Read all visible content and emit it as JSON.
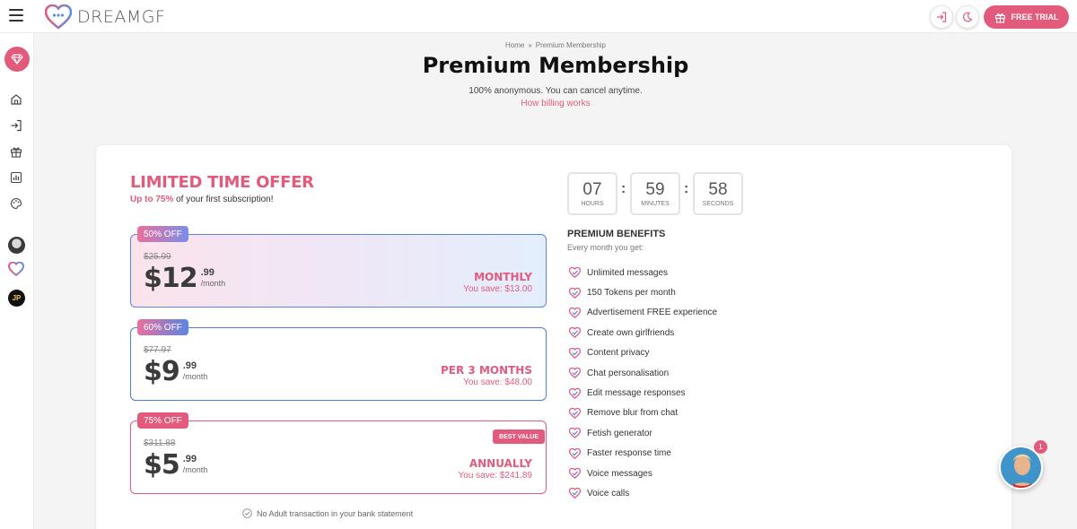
{
  "header": {
    "logo_text": "DREAMGF",
    "free_trial_label": "FREE TRIAL",
    "icons": [
      "menu-icon",
      "login-icon",
      "moon-icon",
      "gift-icon"
    ]
  },
  "sidebar": {
    "icons": [
      "diamond-icon",
      "home-icon",
      "login-icon",
      "gift-icon",
      "chart-icon",
      "palette-icon"
    ],
    "avatars": [
      "anime-avatar",
      "heart-avatar"
    ],
    "user_initials": "JP"
  },
  "breadcrumb": {
    "home": "Home",
    "separator": "»",
    "current": "Premium Membership"
  },
  "page": {
    "title": "Premium Membership",
    "subtitle": "100% anonymous. You can cancel anytime.",
    "billing_link": "How billing works"
  },
  "offer": {
    "title": "LIMITED TIME OFFER",
    "subtitle_highlight": "Up to 75%",
    "subtitle_rest": " of your first subscription!"
  },
  "plans": [
    {
      "discount": "50% OFF",
      "old_price": "$25.99",
      "price_main": "$12",
      "price_cents": ".99",
      "per": "/month",
      "period": "MONTHLY",
      "save": "You save: $13.00",
      "selected": true
    },
    {
      "discount": "60% OFF",
      "old_price": "$77.97",
      "price_main": "$9",
      "price_cents": ".99",
      "per": "/month",
      "period": "PER 3 MONTHS",
      "save": "You save: $48.00"
    },
    {
      "discount": "75% OFF",
      "old_price": "$311.88",
      "price_main": "$5",
      "price_cents": ".99",
      "per": "/month",
      "period": "ANNUALLY",
      "save": "You save: $241.89",
      "best_value": "BEST VALUE"
    }
  ],
  "no_adult": "No Adult transaction in your bank statement",
  "countdown": {
    "hours": "07",
    "hours_label": "HOURS",
    "minutes": "59",
    "minutes_label": "MINUTES",
    "seconds": "58",
    "seconds_label": "SECONDS",
    "separator": ":"
  },
  "benefits": {
    "title": "PREMIUM BENEFITS",
    "subtitle": "Every month you get:",
    "items": [
      "Unlimited messages",
      "150 Tokens per month",
      "Advertisement FREE experience",
      "Create own girlfriends",
      "Content privacy",
      "Chat personalisation",
      "Edit message responses",
      "Remove blur from chat",
      "Fetish generator",
      "Faster response time",
      "Voice messages",
      "Voice calls"
    ]
  },
  "chat": {
    "unread_count": "1"
  },
  "colors": {
    "accent": "#e25b7d",
    "blue": "#4a7fd6"
  }
}
